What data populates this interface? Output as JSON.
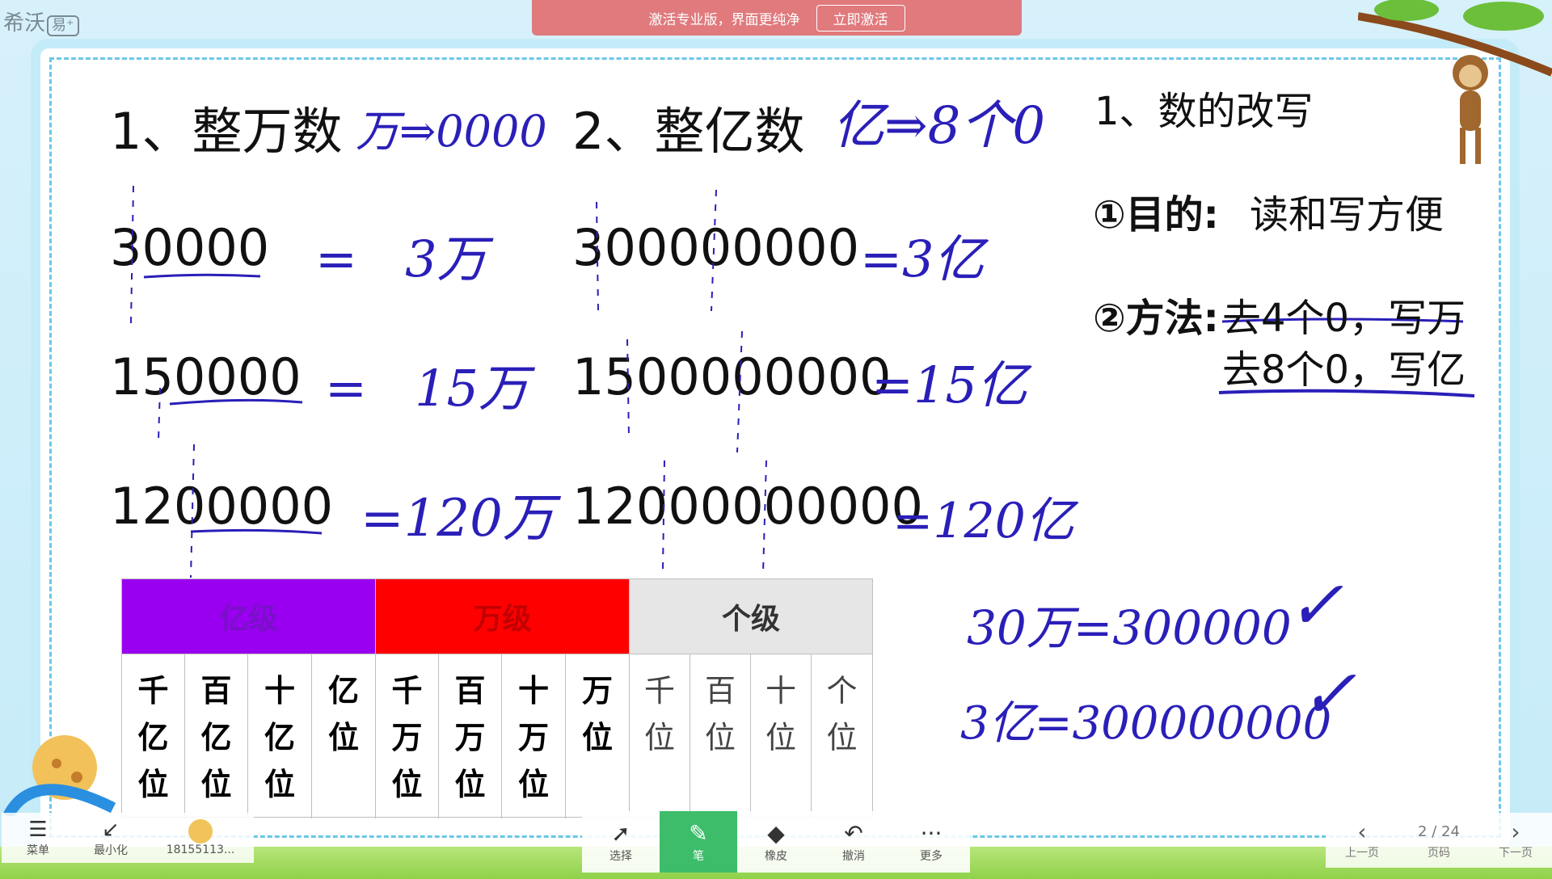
{
  "brand": {
    "name": "希沃",
    "tag": "易⁺"
  },
  "banner": {
    "text": "激活专业版，界面更纯净",
    "button": "立即激活"
  },
  "slide": {
    "title1": "1、整万数",
    "title1_note": "万⇒0000",
    "title2": "2、整亿数",
    "title2_note": "亿⇒8个0",
    "left_numbers": [
      "30000",
      "150000",
      "1200000"
    ],
    "left_results": [
      "=   3万",
      "=   15万",
      "=120万"
    ],
    "mid_numbers": [
      "300000000",
      "1500000000",
      "12000000000"
    ],
    "mid_results": [
      "=3亿",
      "=15亿",
      "=120亿"
    ],
    "right_title": "1、数的改写",
    "purpose_label": "①目的:",
    "purpose_text": "读和写方便",
    "method_label": "②方法:",
    "method_line1": "去4个0，写万",
    "method_line2": "去8个0，写亿",
    "check1": "30万=300000",
    "check2": "3亿=300000000",
    "checkmark": "✓"
  },
  "table": {
    "groups": [
      {
        "label": "亿级",
        "color": "#9a00f0"
      },
      {
        "label": "万级",
        "color": "#ff0000"
      },
      {
        "label": "个级",
        "color": "#e6e6e6"
      }
    ],
    "columns": [
      "千亿位",
      "百亿位",
      "十亿位",
      "亿位",
      "千万位",
      "百万位",
      "十万位",
      "万位",
      "千位",
      "百位",
      "十位",
      "个位"
    ]
  },
  "toolbar": {
    "menu": "菜单",
    "minimize": "最小化",
    "user": "18155113...",
    "tools": [
      {
        "label": "选择",
        "icon": "pointer-icon"
      },
      {
        "label": "笔",
        "icon": "pen-icon"
      },
      {
        "label": "橡皮",
        "icon": "eraser-icon"
      },
      {
        "label": "撤消",
        "icon": "undo-icon"
      },
      {
        "label": "更多",
        "icon": "more-icon"
      }
    ],
    "prev": "上一页",
    "page": "2 / 24",
    "page_label": "页码",
    "next": "下一页"
  }
}
